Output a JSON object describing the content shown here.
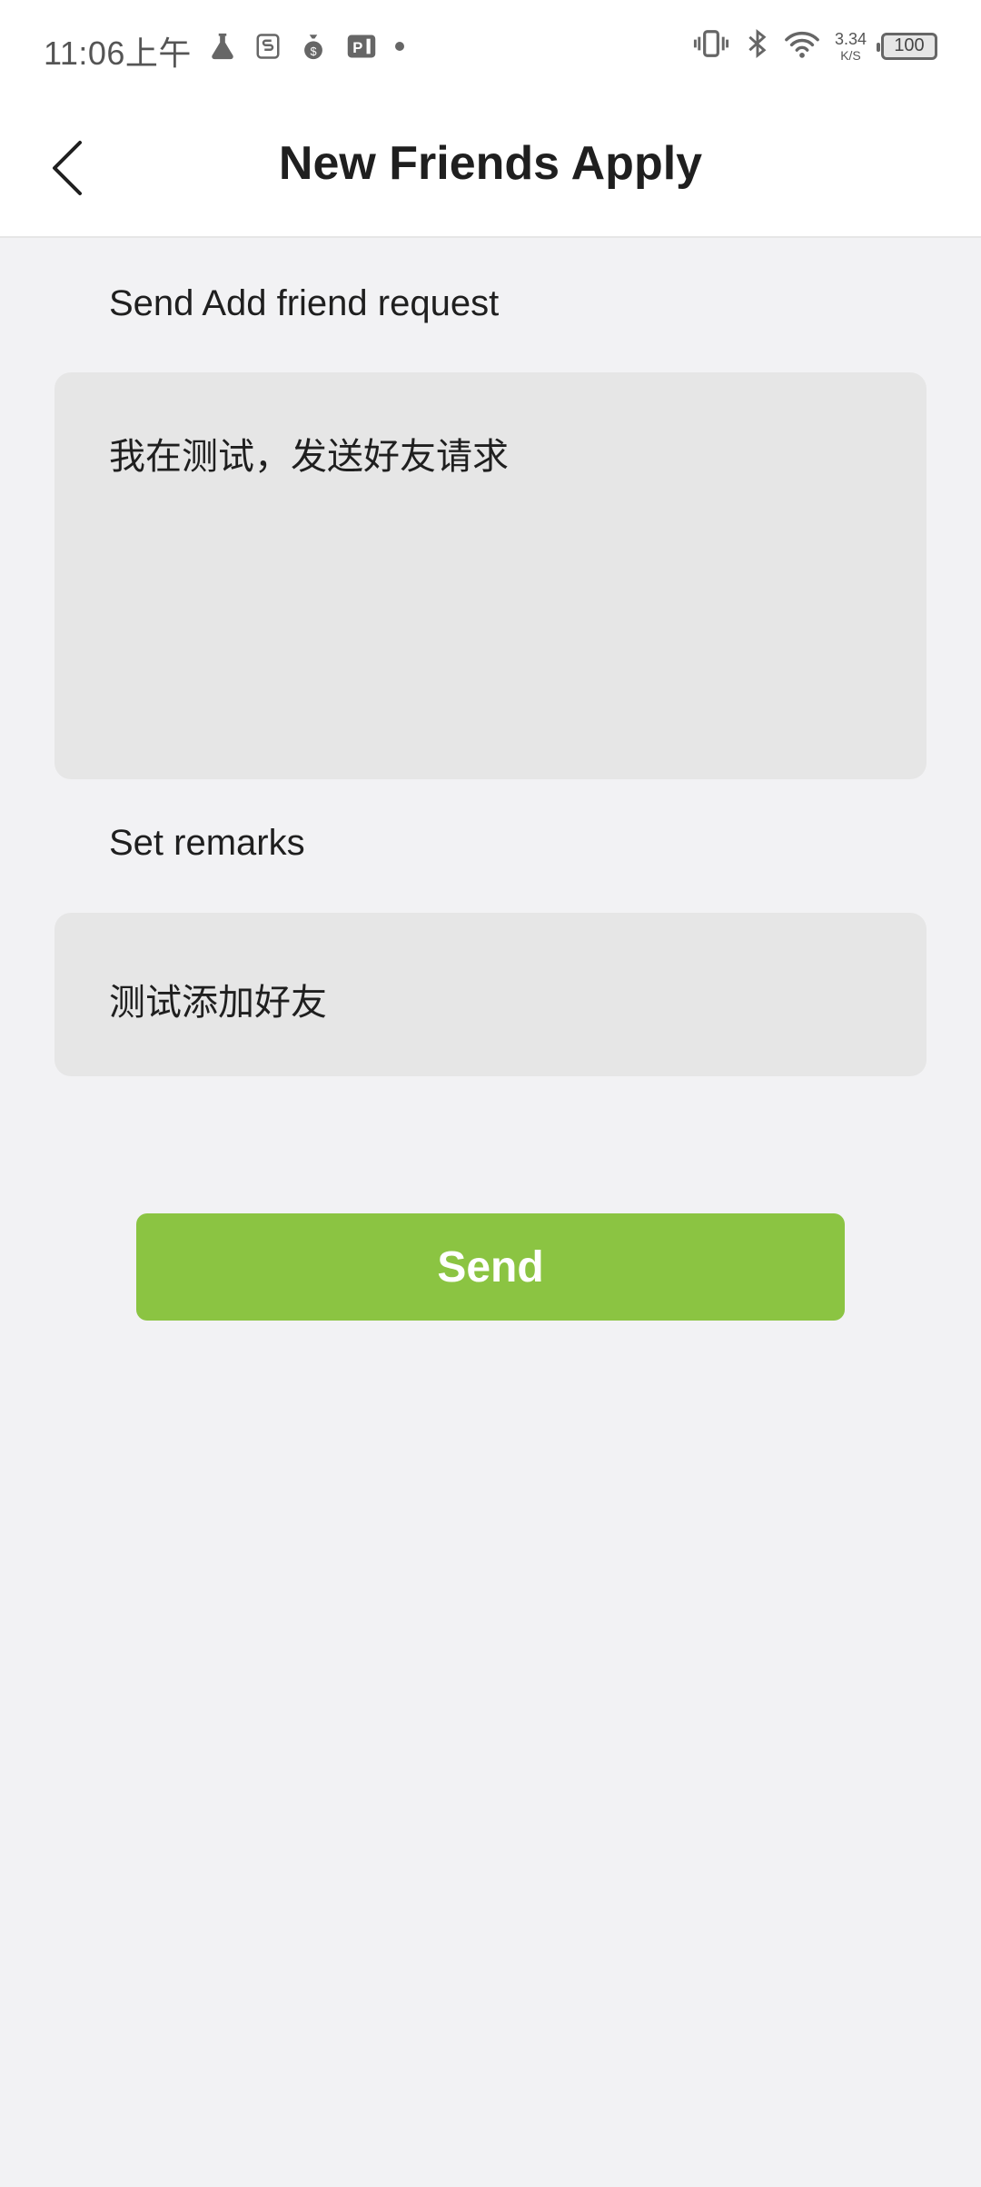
{
  "status_bar": {
    "time": "11:06上午",
    "net_speed_value": "3.34",
    "net_speed_unit": "K/S",
    "battery": "100"
  },
  "header": {
    "title": "New Friends Apply"
  },
  "form": {
    "request_label": "Send Add friend request",
    "request_message": "我在测试，发送好友请求",
    "remarks_label": "Set remarks",
    "remarks_value": "测试添加好友"
  },
  "actions": {
    "send_label": "Send"
  },
  "colors": {
    "accent": "#8bc442",
    "background": "#f2f2f4",
    "input_background": "#e6e6e6"
  }
}
